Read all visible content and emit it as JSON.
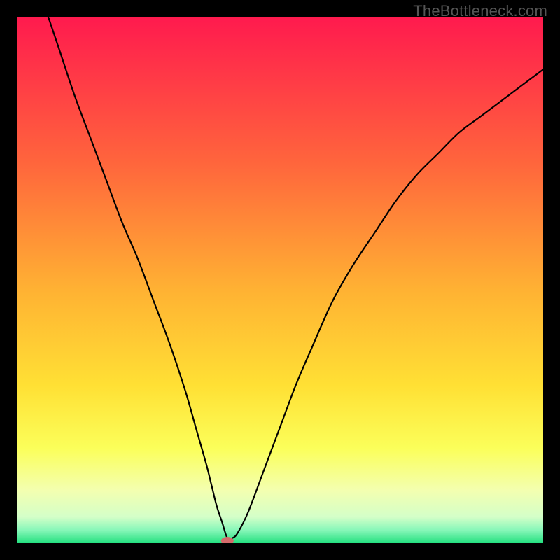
{
  "watermark": "TheBottleneck.com",
  "chart_data": {
    "type": "line",
    "title": "",
    "xlabel": "",
    "ylabel": "",
    "xlim": [
      0,
      100
    ],
    "ylim": [
      0,
      100
    ],
    "marker": {
      "x": 40,
      "y": 0,
      "color": "#d46a6a"
    },
    "gradient_stops": [
      {
        "offset": 0.0,
        "color": "#ff1a4e"
      },
      {
        "offset": 0.28,
        "color": "#ff663c"
      },
      {
        "offset": 0.52,
        "color": "#ffb233"
      },
      {
        "offset": 0.7,
        "color": "#ffe034"
      },
      {
        "offset": 0.82,
        "color": "#fbff5a"
      },
      {
        "offset": 0.9,
        "color": "#f3ffb0"
      },
      {
        "offset": 0.95,
        "color": "#d4ffc8"
      },
      {
        "offset": 0.975,
        "color": "#88f7b9"
      },
      {
        "offset": 1.0,
        "color": "#24e07f"
      }
    ],
    "series": [
      {
        "name": "curve",
        "x": [
          0,
          2,
          5,
          8,
          11,
          14,
          17,
          20,
          23,
          26,
          29,
          32,
          34,
          36,
          37,
          38,
          39,
          40,
          41,
          42,
          44,
          47,
          50,
          53,
          56,
          60,
          64,
          68,
          72,
          76,
          80,
          84,
          88,
          92,
          96,
          100
        ],
        "y": [
          120,
          113,
          103,
          94,
          85,
          77,
          69,
          61,
          54,
          46,
          38,
          29,
          22,
          15,
          11,
          7,
          4,
          1,
          1,
          2,
          6,
          14,
          22,
          30,
          37,
          46,
          53,
          59,
          65,
          70,
          74,
          78,
          81,
          84,
          87,
          90
        ]
      }
    ]
  }
}
